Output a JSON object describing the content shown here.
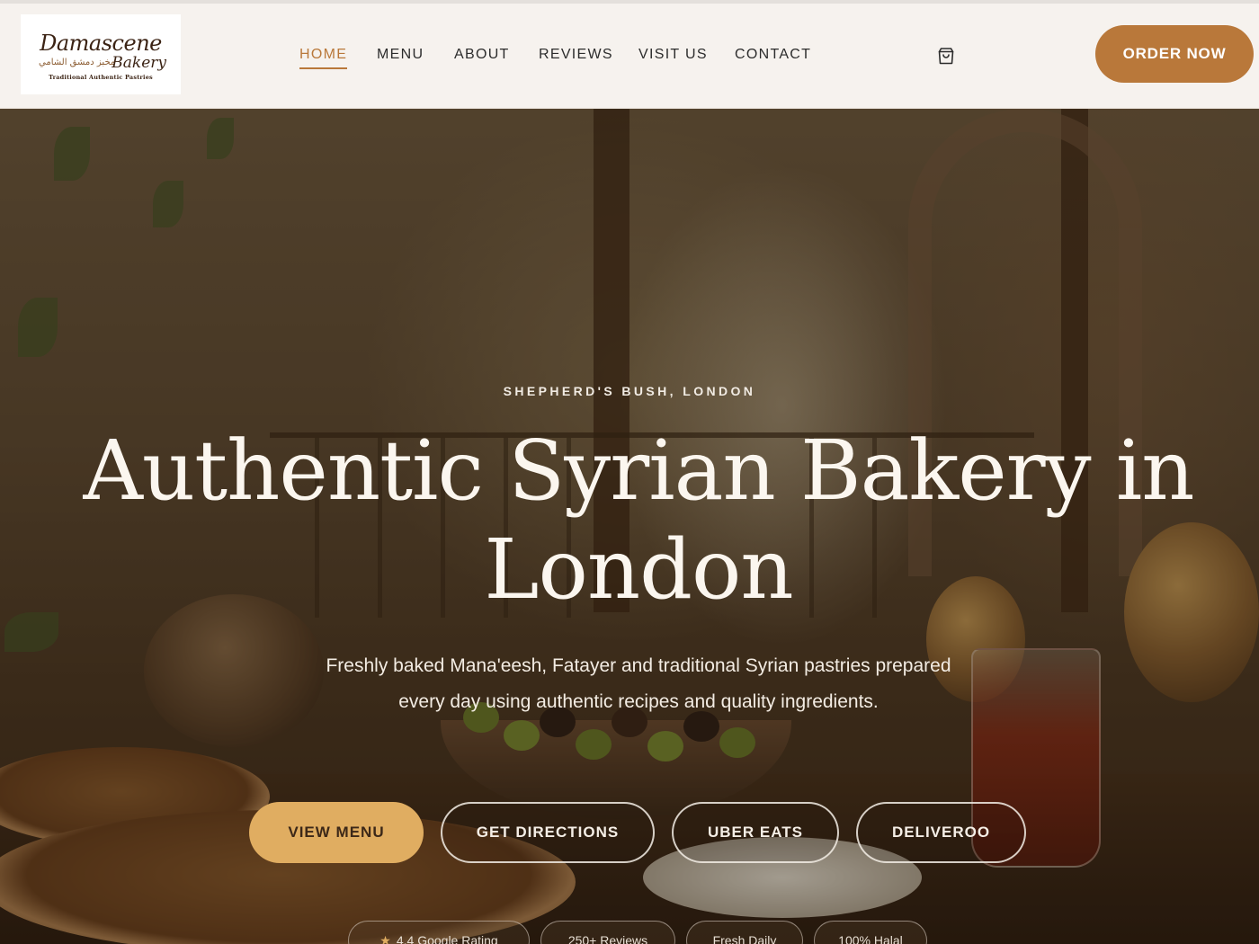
{
  "header": {
    "logo": {
      "line1": "Damascene",
      "line2": "Bakery",
      "arabic": "مخبز دمشق الشامي",
      "tagline": "Traditional Authentic Pastries"
    },
    "nav": [
      {
        "label": "HOME",
        "active": true
      },
      {
        "label": "MENU",
        "active": false
      },
      {
        "label": "ABOUT",
        "active": false
      },
      {
        "label": "REVIEWS",
        "active": false
      },
      {
        "label": "VISIT US",
        "active": false
      },
      {
        "label": "CONTACT",
        "active": false
      }
    ],
    "cart_icon": "shopping-bag-icon",
    "order_label": "ORDER NOW"
  },
  "hero": {
    "kicker": "SHEPHERD'S BUSH, LONDON",
    "title": "Authentic Syrian Bakery in London",
    "subtitle": "Freshly baked Mana'eesh, Fatayer and traditional Syrian pastries prepared every day using authentic recipes and quality ingredients.",
    "buttons": [
      {
        "label": "VIEW MENU",
        "style": "primary"
      },
      {
        "label": "GET DIRECTIONS",
        "style": "outline"
      },
      {
        "label": "UBER EATS",
        "style": "outline"
      },
      {
        "label": "DELIVEROO",
        "style": "outline"
      }
    ],
    "badges": [
      {
        "label": "4.4 Google Rating",
        "icon": "star-icon"
      },
      {
        "label": "250+ Reviews"
      },
      {
        "label": "Fresh Daily"
      },
      {
        "label": "100% Halal"
      }
    ]
  },
  "colors": {
    "accent": "#b9783a",
    "primary_button": "#e0ad61",
    "header_bg": "#f6f2ee"
  }
}
